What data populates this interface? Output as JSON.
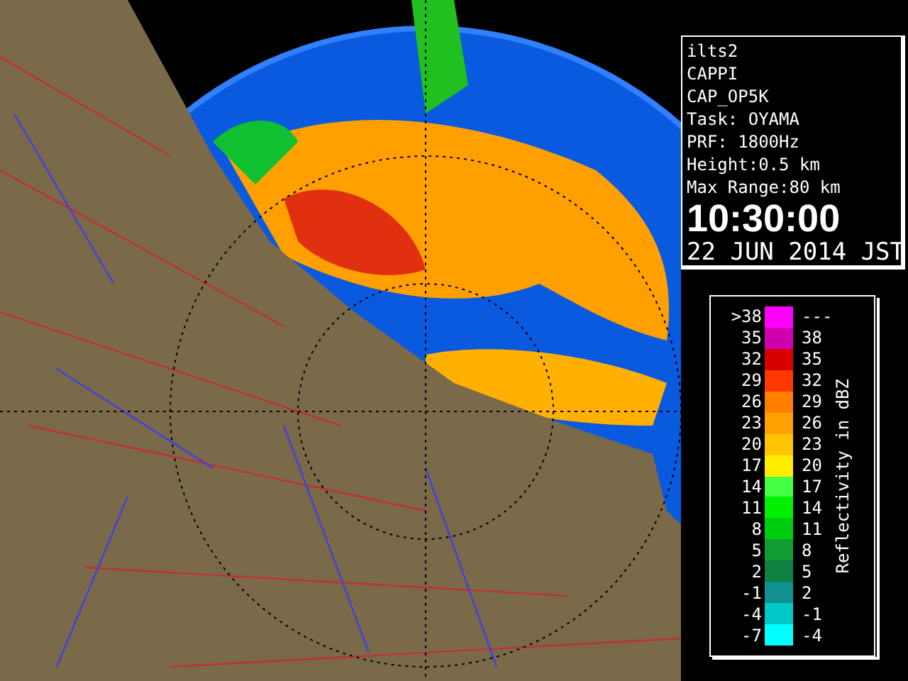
{
  "info": {
    "lines": [
      "ilts2",
      "CAPPI",
      "CAP_OP5K",
      "Task: OYAMA",
      "PRF: 1800Hz",
      "Height:0.5 km",
      "Max Range:80 km"
    ],
    "time": "10:30:00",
    "date": "22 JUN 2014 JST"
  },
  "legend": {
    "title": "Reflectivity in dBZ",
    "rows": [
      {
        "low": ">38",
        "high": "---",
        "color": "#ff00ff"
      },
      {
        "low": "35",
        "high": "38",
        "color": "#d000b0"
      },
      {
        "low": "32",
        "high": "35",
        "color": "#d80000"
      },
      {
        "low": "29",
        "high": "32",
        "color": "#ff3800"
      },
      {
        "low": "26",
        "high": "29",
        "color": "#ff8000"
      },
      {
        "low": "23",
        "high": "26",
        "color": "#ffa000"
      },
      {
        "low": "20",
        "high": "23",
        "color": "#ffc400"
      },
      {
        "low": "17",
        "high": "20",
        "color": "#ffee00"
      },
      {
        "low": "14",
        "high": "17",
        "color": "#44ff44"
      },
      {
        "low": "11",
        "high": "14",
        "color": "#00f000"
      },
      {
        "low": "8",
        "high": "11",
        "color": "#00cc10"
      },
      {
        "low": "5",
        "high": "8",
        "color": "#109c30"
      },
      {
        "low": "2",
        "high": "5",
        "color": "#108040"
      },
      {
        "low": "-1",
        "high": "2",
        "color": "#109090"
      },
      {
        "low": "-4",
        "high": "-1",
        "color": "#00c8c8"
      },
      {
        "low": "-7",
        "high": "-4",
        "color": "#00ffff"
      }
    ]
  }
}
